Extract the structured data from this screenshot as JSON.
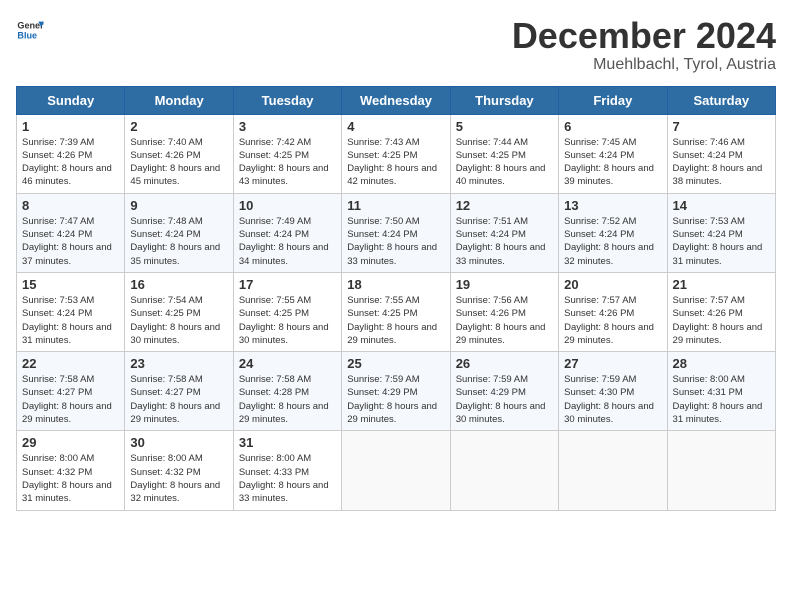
{
  "header": {
    "logo_general": "General",
    "logo_blue": "Blue",
    "title": "December 2024",
    "subtitle": "Muehlbachl, Tyrol, Austria"
  },
  "weekdays": [
    "Sunday",
    "Monday",
    "Tuesday",
    "Wednesday",
    "Thursday",
    "Friday",
    "Saturday"
  ],
  "weeks": [
    [
      {
        "day": "1",
        "sunrise": "7:39 AM",
        "sunset": "4:26 PM",
        "daylight": "8 hours and 46 minutes."
      },
      {
        "day": "2",
        "sunrise": "7:40 AM",
        "sunset": "4:26 PM",
        "daylight": "8 hours and 45 minutes."
      },
      {
        "day": "3",
        "sunrise": "7:42 AM",
        "sunset": "4:25 PM",
        "daylight": "8 hours and 43 minutes."
      },
      {
        "day": "4",
        "sunrise": "7:43 AM",
        "sunset": "4:25 PM",
        "daylight": "8 hours and 42 minutes."
      },
      {
        "day": "5",
        "sunrise": "7:44 AM",
        "sunset": "4:25 PM",
        "daylight": "8 hours and 40 minutes."
      },
      {
        "day": "6",
        "sunrise": "7:45 AM",
        "sunset": "4:24 PM",
        "daylight": "8 hours and 39 minutes."
      },
      {
        "day": "7",
        "sunrise": "7:46 AM",
        "sunset": "4:24 PM",
        "daylight": "8 hours and 38 minutes."
      }
    ],
    [
      {
        "day": "8",
        "sunrise": "7:47 AM",
        "sunset": "4:24 PM",
        "daylight": "8 hours and 37 minutes."
      },
      {
        "day": "9",
        "sunrise": "7:48 AM",
        "sunset": "4:24 PM",
        "daylight": "8 hours and 35 minutes."
      },
      {
        "day": "10",
        "sunrise": "7:49 AM",
        "sunset": "4:24 PM",
        "daylight": "8 hours and 34 minutes."
      },
      {
        "day": "11",
        "sunrise": "7:50 AM",
        "sunset": "4:24 PM",
        "daylight": "8 hours and 33 minutes."
      },
      {
        "day": "12",
        "sunrise": "7:51 AM",
        "sunset": "4:24 PM",
        "daylight": "8 hours and 33 minutes."
      },
      {
        "day": "13",
        "sunrise": "7:52 AM",
        "sunset": "4:24 PM",
        "daylight": "8 hours and 32 minutes."
      },
      {
        "day": "14",
        "sunrise": "7:53 AM",
        "sunset": "4:24 PM",
        "daylight": "8 hours and 31 minutes."
      }
    ],
    [
      {
        "day": "15",
        "sunrise": "7:53 AM",
        "sunset": "4:24 PM",
        "daylight": "8 hours and 31 minutes."
      },
      {
        "day": "16",
        "sunrise": "7:54 AM",
        "sunset": "4:25 PM",
        "daylight": "8 hours and 30 minutes."
      },
      {
        "day": "17",
        "sunrise": "7:55 AM",
        "sunset": "4:25 PM",
        "daylight": "8 hours and 30 minutes."
      },
      {
        "day": "18",
        "sunrise": "7:55 AM",
        "sunset": "4:25 PM",
        "daylight": "8 hours and 29 minutes."
      },
      {
        "day": "19",
        "sunrise": "7:56 AM",
        "sunset": "4:26 PM",
        "daylight": "8 hours and 29 minutes."
      },
      {
        "day": "20",
        "sunrise": "7:57 AM",
        "sunset": "4:26 PM",
        "daylight": "8 hours and 29 minutes."
      },
      {
        "day": "21",
        "sunrise": "7:57 AM",
        "sunset": "4:26 PM",
        "daylight": "8 hours and 29 minutes."
      }
    ],
    [
      {
        "day": "22",
        "sunrise": "7:58 AM",
        "sunset": "4:27 PM",
        "daylight": "8 hours and 29 minutes."
      },
      {
        "day": "23",
        "sunrise": "7:58 AM",
        "sunset": "4:27 PM",
        "daylight": "8 hours and 29 minutes."
      },
      {
        "day": "24",
        "sunrise": "7:58 AM",
        "sunset": "4:28 PM",
        "daylight": "8 hours and 29 minutes."
      },
      {
        "day": "25",
        "sunrise": "7:59 AM",
        "sunset": "4:29 PM",
        "daylight": "8 hours and 29 minutes."
      },
      {
        "day": "26",
        "sunrise": "7:59 AM",
        "sunset": "4:29 PM",
        "daylight": "8 hours and 30 minutes."
      },
      {
        "day": "27",
        "sunrise": "7:59 AM",
        "sunset": "4:30 PM",
        "daylight": "8 hours and 30 minutes."
      },
      {
        "day": "28",
        "sunrise": "8:00 AM",
        "sunset": "4:31 PM",
        "daylight": "8 hours and 31 minutes."
      }
    ],
    [
      {
        "day": "29",
        "sunrise": "8:00 AM",
        "sunset": "4:32 PM",
        "daylight": "8 hours and 31 minutes."
      },
      {
        "day": "30",
        "sunrise": "8:00 AM",
        "sunset": "4:32 PM",
        "daylight": "8 hours and 32 minutes."
      },
      {
        "day": "31",
        "sunrise": "8:00 AM",
        "sunset": "4:33 PM",
        "daylight": "8 hours and 33 minutes."
      },
      null,
      null,
      null,
      null
    ]
  ],
  "labels": {
    "sunrise": "Sunrise:",
    "sunset": "Sunset:",
    "daylight": "Daylight:"
  }
}
